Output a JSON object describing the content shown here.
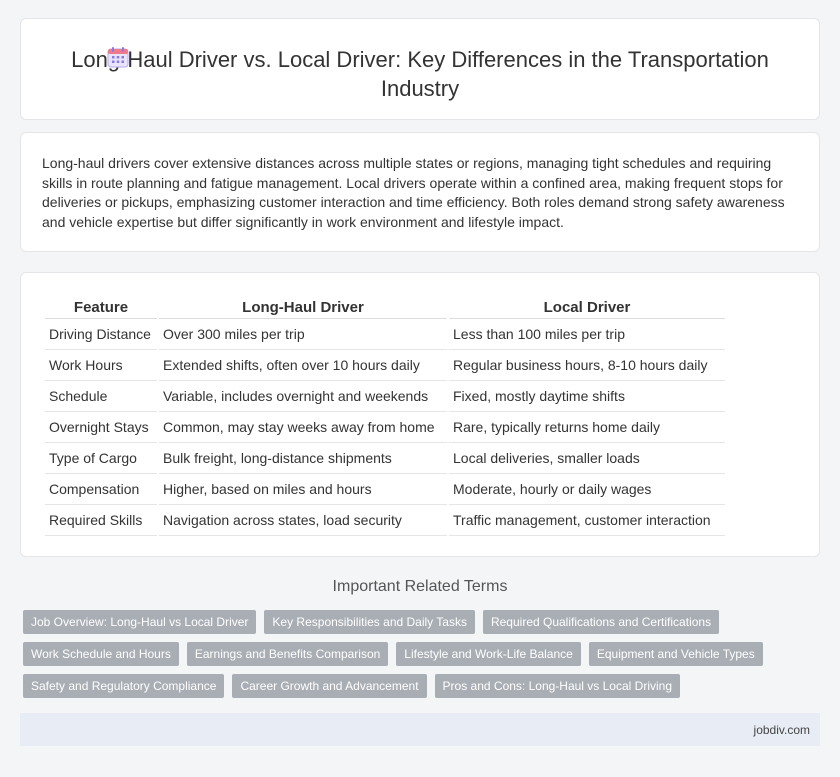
{
  "header": {
    "icon": "calendar-icon",
    "title": "Long-Haul Driver vs. Local Driver: Key Differences in the Transportation Industry"
  },
  "intro": {
    "text": "Long-haul drivers cover extensive distances across multiple states or regions, managing tight schedules and requiring skills in route planning and fatigue management. Local drivers operate within a confined area, making frequent stops for deliveries or pickups, emphasizing customer interaction and time efficiency. Both roles demand strong safety awareness and vehicle expertise but differ significantly in work environment and lifestyle impact."
  },
  "table": {
    "headers": [
      "Feature",
      "Long-Haul Driver",
      "Local Driver"
    ],
    "rows": [
      [
        "Driving Distance",
        "Over 300 miles per trip",
        "Less than 100 miles per trip"
      ],
      [
        "Work Hours",
        "Extended shifts, often over 10 hours daily",
        "Regular business hours, 8-10 hours daily"
      ],
      [
        "Schedule",
        "Variable, includes overnight and weekends",
        "Fixed, mostly daytime shifts"
      ],
      [
        "Overnight Stays",
        "Common, may stay weeks away from home",
        "Rare, typically returns home daily"
      ],
      [
        "Type of Cargo",
        "Bulk freight, long-distance shipments",
        "Local deliveries, smaller loads"
      ],
      [
        "Compensation",
        "Higher, based on miles and hours",
        "Moderate, hourly or daily wages"
      ],
      [
        "Required Skills",
        "Navigation across states, load security",
        "Traffic management, customer interaction"
      ]
    ]
  },
  "related": {
    "title": "Important Related Terms",
    "rows": [
      [
        "Job Overview: Long-Haul vs Local Driver",
        "Key Responsibilities and Daily Tasks",
        "Required Qualifications and Certifications"
      ],
      [
        "Work Schedule and Hours",
        "Earnings and Benefits Comparison",
        "Lifestyle and Work-Life Balance",
        "Equipment and Vehicle Types"
      ],
      [
        "Safety and Regulatory Compliance",
        "Career Growth and Advancement",
        "Pros and Cons: Long-Haul vs Local Driving"
      ]
    ]
  },
  "footer": {
    "text": "jobdiv.com"
  }
}
